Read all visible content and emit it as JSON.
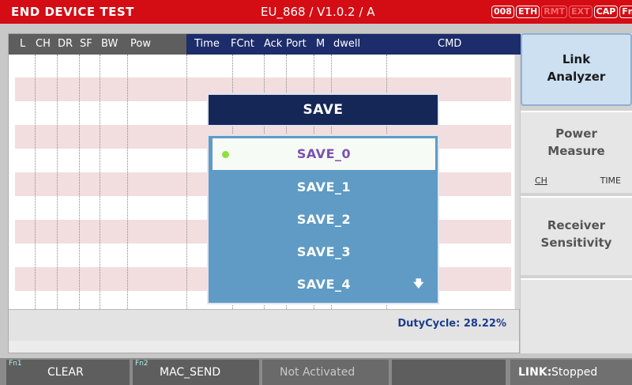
{
  "titlebar": {
    "title": "END DEVICE TEST",
    "mode": "EU_868 / V1.0.2 / A",
    "badges": [
      "008",
      "ETH",
      "RMT",
      "EXT",
      "CAP",
      "Fn"
    ]
  },
  "table": {
    "left_headers": [
      "L",
      "CH",
      "DR",
      "SF",
      "BW",
      "Pow"
    ],
    "right_headers": [
      "Time",
      "FCnt",
      "Ack",
      "Port",
      "M",
      "dwell",
      "CMD"
    ]
  },
  "status": {
    "duty_cycle": "DutyCycle: 28.22%"
  },
  "save_dialog": {
    "title": "SAVE",
    "items": [
      "SAVE_0",
      "SAVE_1",
      "SAVE_2",
      "SAVE_3",
      "SAVE_4"
    ],
    "selected_index": 0,
    "scroll_icon": "down-arrow-icon"
  },
  "right_panel": {
    "link_analyzer": [
      "Link",
      "Analyzer"
    ],
    "power_measure": [
      "Power",
      "Measure"
    ],
    "power_sub": [
      "CH",
      "TIME"
    ],
    "receiver_sensitivity": [
      "Receiver",
      "Sensitivity"
    ]
  },
  "softkeys": {
    "fn1": "Fn1",
    "f1": "CLEAR",
    "fn2": "Fn2",
    "f2": "MAC_SEND",
    "f3": "Not Activated",
    "link_label": "LINK:",
    "link_status": "Stopped"
  },
  "colors": {
    "titlebar": "#d40c14",
    "header_dark": "#1d2d6b",
    "dialog_body": "#5f9bc4",
    "selected_text": "#7b52b2",
    "selected_dot": "#8ee03e"
  }
}
